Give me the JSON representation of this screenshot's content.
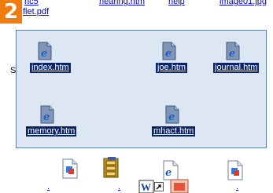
{
  "step": {
    "number": "2"
  },
  "top_files": {
    "partial_labels": [
      "nc5",
      "nearing.htm",
      "help",
      "image01.jpg"
    ],
    "leaflet": "flet.pdf"
  },
  "side_label": "S",
  "selected_files": [
    {
      "name": "index.htm",
      "icon": "ie-document-icon"
    },
    {
      "name": "joe.htm",
      "icon": "ie-document-icon"
    },
    {
      "name": "journal.htm",
      "icon": "ie-document-icon"
    },
    {
      "name": "memory.htm",
      "icon": "ie-document-icon"
    },
    {
      "name": "mhact.htm",
      "icon": "ie-document-icon"
    }
  ],
  "bottom_files": [
    {
      "icon": "image-document-icon"
    },
    {
      "icon": "archive-cabinet-icon"
    },
    {
      "icon": "ie-document-icon"
    },
    {
      "icon": "image-document-icon"
    }
  ],
  "drag_icons": [
    "word-document-icon",
    "shortcut-arrow-icon",
    "image-document-icon"
  ],
  "colors": {
    "step_badge": "#f07c10",
    "selection_fill": "#dde7f3",
    "selection_border": "#5b7fa8",
    "label_highlight": "#0a246a"
  }
}
